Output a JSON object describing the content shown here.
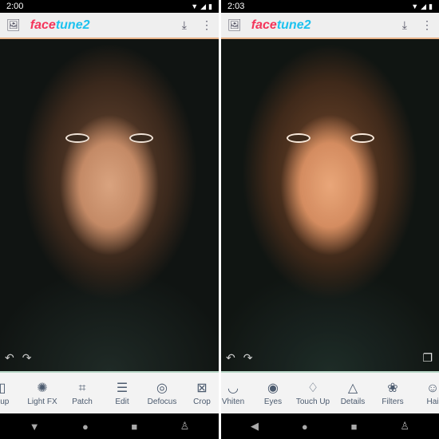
{
  "app": {
    "logo_a": "face",
    "logo_b": "tune2"
  },
  "left": {
    "time": "2:00",
    "tools": [
      {
        "label": "eup",
        "icon": "makeup-icon",
        "g": "▯"
      },
      {
        "label": "Light FX",
        "icon": "light-fx-icon",
        "g": "✺"
      },
      {
        "label": "Patch",
        "icon": "patch-icon",
        "g": "⌗"
      },
      {
        "label": "Edit",
        "icon": "sliders-icon",
        "g": "☰"
      },
      {
        "label": "Defocus",
        "icon": "defocus-icon",
        "g": "◎"
      },
      {
        "label": "Crop",
        "icon": "crop-icon",
        "g": "⊠"
      }
    ]
  },
  "right": {
    "time": "2:03",
    "tools": [
      {
        "label": "Vhiten",
        "icon": "whiten-icon",
        "g": "◡"
      },
      {
        "label": "Eyes",
        "icon": "eye-icon",
        "g": "◉"
      },
      {
        "label": "Touch Up",
        "icon": "drop-icon",
        "g": "♢"
      },
      {
        "label": "Details",
        "icon": "triangle-icon",
        "g": "△"
      },
      {
        "label": "Filters",
        "icon": "filters-icon",
        "g": "❀"
      },
      {
        "label": "Hai",
        "icon": "hair-icon",
        "g": "☺"
      }
    ]
  }
}
